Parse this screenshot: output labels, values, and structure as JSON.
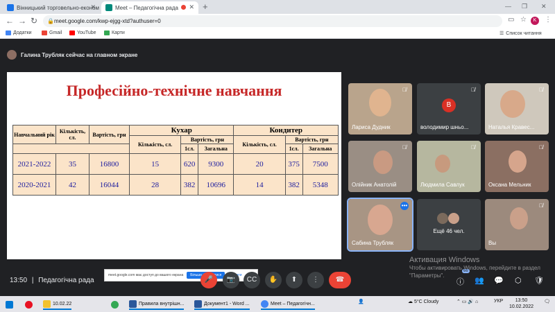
{
  "browser": {
    "tabs": [
      {
        "title": "Вінницький торговельно-економ",
        "active": false
      },
      {
        "title": "Meet – Педагогічна рада",
        "active": true
      }
    ],
    "url": "meet.google.com/kwp-ejgg-xtd?authuser=0",
    "profile_initial": "K",
    "bookmarks": [
      "Додатки",
      "Gmail",
      "YouTube",
      "Карти"
    ],
    "reading_list": "Список читання"
  },
  "meet": {
    "presenter_text": "Галина Трубляк сейчас на главном экране",
    "time": "13:50",
    "meeting_title": "Педагогічна рада",
    "participants_badge": "66",
    "share_notice": {
      "text": "meet.google.com має доступ до вашого екрана",
      "stop": "Більше не ділитися",
      "hide": "Сховати"
    },
    "tiles": [
      {
        "name": "Лариса Дудник"
      },
      {
        "name": "володимир шньо...",
        "initial": "В"
      },
      {
        "name": "Наталья Кравес..."
      },
      {
        "name": "Олійник Анатолій"
      },
      {
        "name": "Людмила Савлук"
      },
      {
        "name": "Оксана Мельник"
      },
      {
        "name": "Сабина Трубляк"
      },
      {
        "name": "Ещё 46 чел."
      },
      {
        "name": "Вы"
      }
    ]
  },
  "slide": {
    "title": "Професійно-технічне навчання",
    "headers": {
      "year": "Навчальний рік",
      "count": "Кількість, сл.",
      "cost": "Вартість, грн",
      "cook": "Кухар",
      "confectioner": "Кондитер",
      "sub_count": "Кількість, сл.",
      "sub_cost": "Вартість, грн",
      "first": "1сл.",
      "total": "Загальна"
    },
    "rows": [
      [
        "2021-2022",
        "35",
        "16800",
        "15",
        "620",
        "9300",
        "20",
        "375",
        "7500"
      ],
      [
        "2020-2021",
        "42",
        "16044",
        "28",
        "382",
        "10696",
        "14",
        "382",
        "5348"
      ]
    ]
  },
  "watermark": {
    "title": "Активация Windows",
    "text": "Чтобы активировать Windows, перейдите в раздел \"Параметры\"."
  },
  "taskbar": {
    "items": [
      "10.02.22",
      "Правила внутрішн...",
      "Документ1 - Word ...",
      "Meet – Педагогічн..."
    ],
    "weather": "5°C  Cloudy",
    "lang": "УКР",
    "time": "13:50",
    "date": "10.02.2022"
  }
}
